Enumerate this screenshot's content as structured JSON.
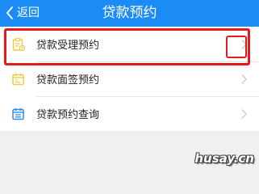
{
  "header": {
    "back_label": "返回",
    "title": "贷款预约",
    "background": "#1b8cf5"
  },
  "list": {
    "items": [
      {
        "label": "贷款受理预约",
        "icon": "clipboard-list-icon",
        "icon_color": "#f2c94c",
        "highlighted": true
      },
      {
        "label": "贷款面签预约",
        "icon": "calendar-icon",
        "icon_color": "#f2c94c",
        "highlighted": false
      },
      {
        "label": "贷款预约查询",
        "icon": "calendar-list-icon",
        "icon_color": "#2f8af5",
        "highlighted": false
      }
    ]
  },
  "annotation": {
    "highlight_color": "#e51a1a"
  },
  "watermark": {
    "text": "husay.cn"
  }
}
